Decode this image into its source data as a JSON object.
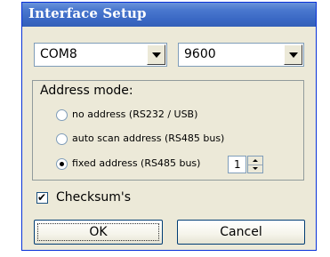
{
  "window": {
    "title": "Interface Setup"
  },
  "port_combo": {
    "value": "COM8"
  },
  "baud_combo": {
    "value": "9600"
  },
  "address_mode": {
    "label": "Address mode:",
    "options": [
      {
        "label": "no address (RS232 / USB)",
        "checked": false
      },
      {
        "label": "auto scan address (RS485 bus)",
        "checked": false
      },
      {
        "label": "fixed address (RS485 bus)",
        "checked": true
      }
    ],
    "fixed_address_value": "1"
  },
  "checksum": {
    "label": "Checksum's",
    "checked": true
  },
  "buttons": {
    "ok": "OK",
    "cancel": "Cancel"
  },
  "icons": {
    "combo_arrow": "chevron-down-icon",
    "spin_up": "spin-up-icon",
    "spin_down": "spin-down-icon",
    "check": "check-icon"
  },
  "colors": {
    "title_bar": "#3a68c4",
    "dialog_bg": "#ece9d8",
    "control_border": "#7f9db9"
  }
}
